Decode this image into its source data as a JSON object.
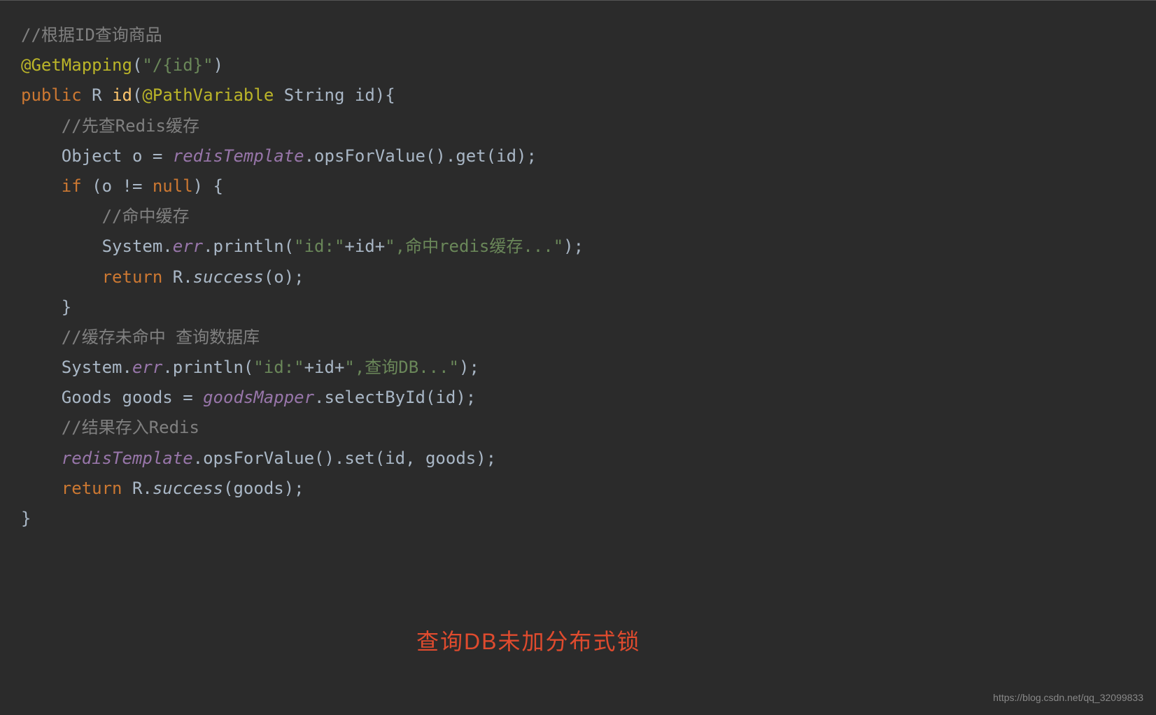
{
  "code": {
    "l1": {
      "c1": "//根据ID查询商品"
    },
    "l2": {
      "a1": "@GetMapping",
      "p1": "(",
      "s1": "\"/{id}\"",
      "p2": ")"
    },
    "l3": {
      "k1": "public ",
      "t1": "R ",
      "m1": "id",
      "p1": "(",
      "a1": "@PathVariable ",
      "t2": "String id",
      "p2": "){"
    },
    "l4": {
      "c1": "    //先查Redis缓存"
    },
    "l5": {
      "t1": "    Object o = ",
      "f1": "redisTemplate",
      "t2": ".opsForValue().get(id);"
    },
    "l6": {
      "k1": "    if ",
      "t1": "(o != ",
      "k2": "null",
      "t2": ") {"
    },
    "l7": {
      "c1": "        //命中缓存"
    },
    "l8": {
      "t1": "        System.",
      "f1": "err",
      "t2": ".println(",
      "s1": "\"id:\"",
      "t3": "+id+",
      "s2": "\",命中redis缓存...\"",
      "t4": ");"
    },
    "l9": {
      "k1": "        return ",
      "t1": "R.",
      "m1": "success",
      "t2": "(o);"
    },
    "l10": {
      "t1": "    }"
    },
    "l11": {
      "t1": ""
    },
    "l12": {
      "c1": "    //缓存未命中 查询数据库"
    },
    "l13": {
      "t1": "    System.",
      "f1": "err",
      "t2": ".println(",
      "s1": "\"id:\"",
      "t3": "+id+",
      "s2": "\",查询DB...\"",
      "t4": ");"
    },
    "l14": {
      "t1": "    Goods goods = ",
      "f1": "goodsMapper",
      "t2": ".selectById(id);"
    },
    "l15": {
      "c1": "    //结果存入Redis"
    },
    "l16": {
      "t1": "    ",
      "f1": "redisTemplate",
      "t2": ".opsForValue().set(id, goods);"
    },
    "l17": {
      "k1": "    return ",
      "t1": "R.",
      "m1": "success",
      "t2": "(goods);"
    },
    "l18": {
      "t1": "}"
    }
  },
  "annotation": "查询DB未加分布式锁",
  "watermark": "https://blog.csdn.net/qq_32099833"
}
